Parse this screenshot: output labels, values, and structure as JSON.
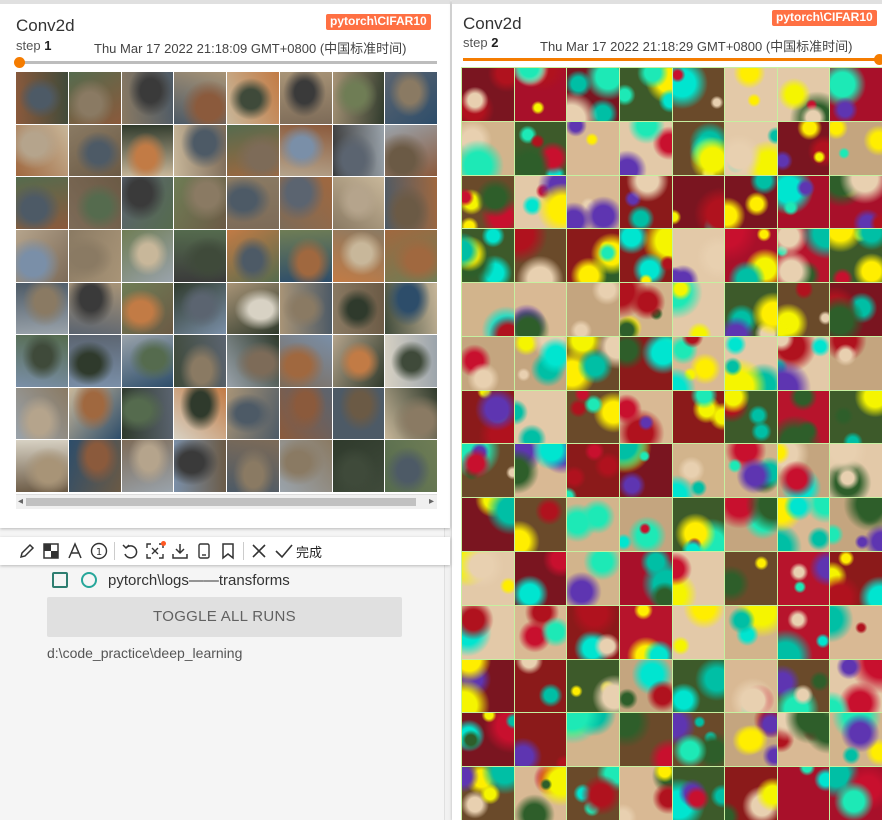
{
  "left_card": {
    "title": "Conv2d",
    "tag": "pytorch\\CIFAR10",
    "step_label": "step",
    "step_value": "1",
    "timestamp": "Thu Mar 17 2022 21:18:09 GMT+0800 (中国标准时间)",
    "image_grid_label": "CIFAR10 input image batch"
  },
  "right_card": {
    "title": "Conv2d",
    "tag": "pytorch\\CIFAR10",
    "step_label": "step",
    "step_value": "2",
    "timestamp": "Thu Mar 17 2022 21:18:29 GMT+0800 (中国标准时间)",
    "image_grid_label": "Conv2d feature map batch"
  },
  "toolbar": {
    "icons": [
      "pen-icon",
      "mosaic-icon",
      "text-icon",
      "number-marker-icon",
      "undo-icon",
      "ocr-icon",
      "download-icon",
      "pin-icon",
      "bookmark-icon",
      "close-icon",
      "check-icon"
    ],
    "done_label": "完成",
    "accent_dot_color": "#ff5722"
  },
  "runs": {
    "items": [
      {
        "label": "pytorch\\logs——transforms",
        "checked": false
      }
    ],
    "toggle_label": "TOGGLE ALL RUNS",
    "log_dir": "d:\\code_practice\\deep_learning"
  },
  "colors": {
    "accent": "#f57c00",
    "tag_bg": "#ff7043",
    "run_color": "#26a69a"
  }
}
